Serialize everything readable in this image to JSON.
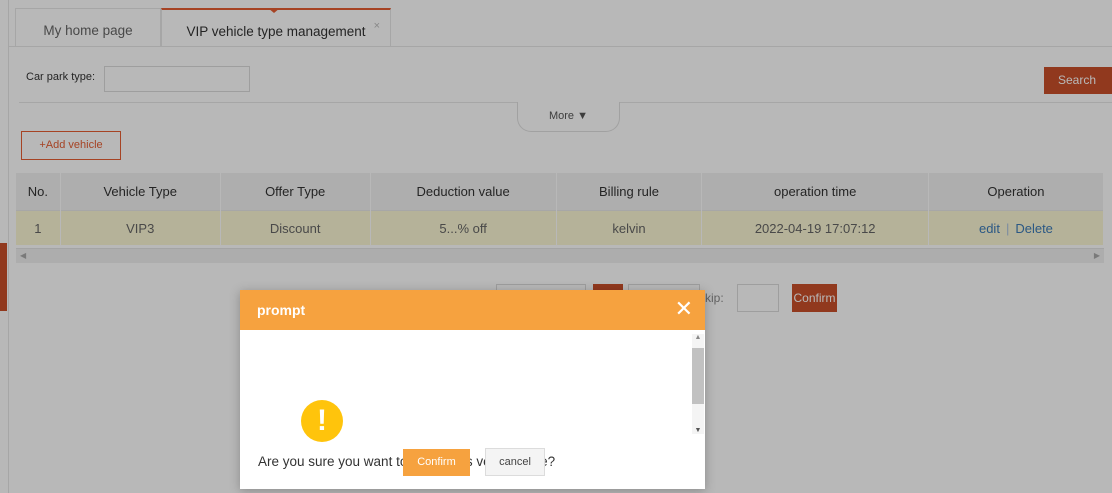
{
  "tabs": {
    "home_label": "My home page",
    "vip_label": "VIP vehicle type management",
    "close_glyph": "×"
  },
  "filter": {
    "car_park_type_label": "Car park type:",
    "car_park_type_value": "",
    "search_label": "Search",
    "more_label": "More ▼"
  },
  "toolbar": {
    "add_vehicle_label": "+Add vehicle"
  },
  "table": {
    "headers": [
      "No.",
      "Vehicle Type",
      "Offer Type",
      "Deduction value",
      "Billing rule",
      "operation time",
      "Operation"
    ],
    "rows": [
      {
        "no": "1",
        "vehicle_type": "VIP3",
        "offer_type": "Discount",
        "deduction_value": "5...% off",
        "billing_rule": "kelvin",
        "operation_time": "2022-04-19 17:07:12",
        "edit_label": "edit",
        "separator": "|",
        "delete_label": "Delete"
      }
    ]
  },
  "pager": {
    "skip_label": "Skip:",
    "skip_value": "",
    "confirm_label": "Confirm"
  },
  "modal": {
    "title": "prompt",
    "close_glyph": "✕",
    "icon": "warning-icon",
    "icon_glyph": "!",
    "message": "Are you sure you want to delete this vehicle type?",
    "confirm_label": "Confirm",
    "cancel_label": "cancel"
  },
  "colors": {
    "accent": "#c9502a",
    "modal_header": "#f6a23f",
    "selected_row": "#fbf7d4",
    "warning": "#ffc40c",
    "link": "#3c7ab8"
  }
}
